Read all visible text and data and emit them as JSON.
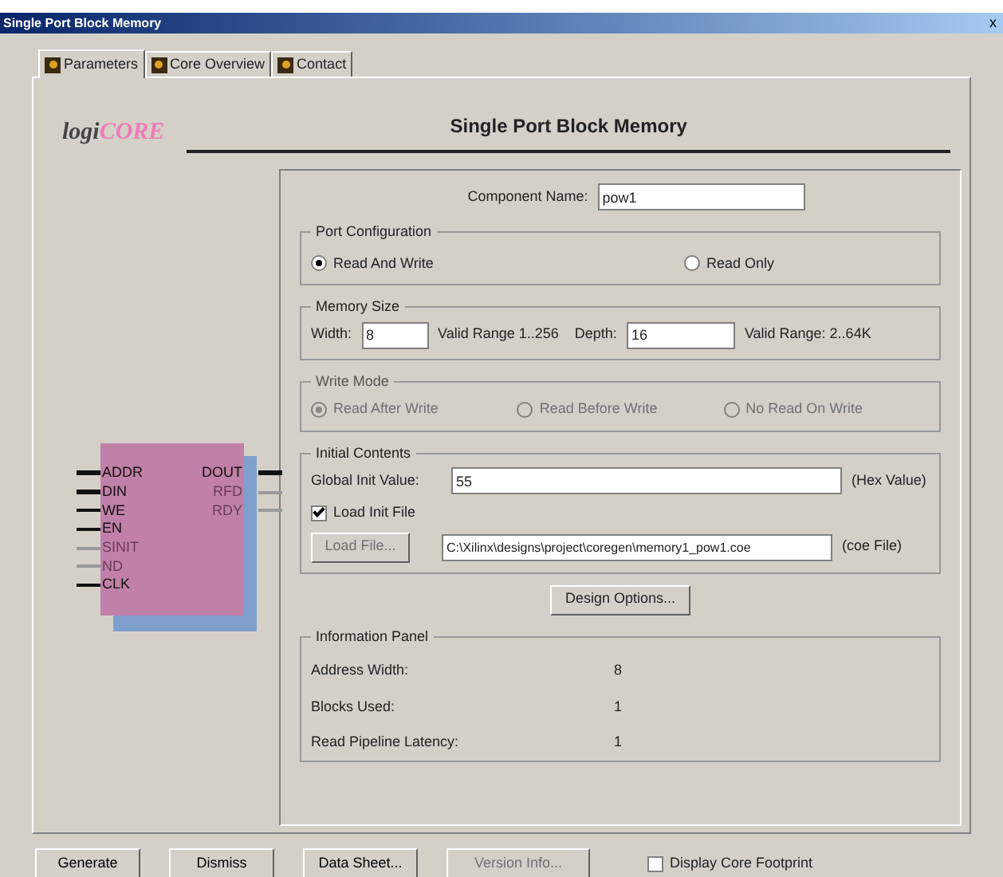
{
  "window": {
    "title": "Single Port Block Memory",
    "close": "x"
  },
  "tabs": [
    {
      "label": "Parameters",
      "selected": true
    },
    {
      "label": "Core Overview",
      "selected": false
    },
    {
      "label": "Contact",
      "selected": false
    }
  ],
  "header": {
    "logo_prefix": "logi",
    "logo_suffix": "CORE",
    "title": "Single Port Block Memory"
  },
  "symbol": {
    "left_pins": [
      {
        "name": "ADDR",
        "bus": true,
        "disabled": false
      },
      {
        "name": "DIN",
        "bus": true,
        "disabled": false
      },
      {
        "name": "WE",
        "bus": false,
        "disabled": false
      },
      {
        "name": "EN",
        "bus": false,
        "disabled": false
      },
      {
        "name": "SINIT",
        "bus": false,
        "disabled": true
      },
      {
        "name": "ND",
        "bus": false,
        "disabled": true
      },
      {
        "name": "CLK",
        "bus": false,
        "disabled": false
      }
    ],
    "right_pins": [
      {
        "name": "DOUT",
        "bus": true,
        "disabled": false
      },
      {
        "name": "RFD",
        "bus": false,
        "disabled": true
      },
      {
        "name": "RDY",
        "bus": false,
        "disabled": true
      }
    ]
  },
  "component_name": {
    "label": "Component Name:",
    "value": "pow1"
  },
  "port_configuration": {
    "title": "Port Configuration",
    "options": [
      {
        "label": "Read And Write",
        "selected": true
      },
      {
        "label": "Read Only",
        "selected": false
      }
    ]
  },
  "memory_size": {
    "title": "Memory Size",
    "width": {
      "label": "Width:",
      "value": "8",
      "range": "Valid Range 1..256"
    },
    "depth": {
      "label": "Depth:",
      "value": "16",
      "range": "Valid Range: 2..64K"
    }
  },
  "write_mode": {
    "title": "Write Mode",
    "disabled": true,
    "options": [
      {
        "label": "Read After Write",
        "selected": true
      },
      {
        "label": "Read Before Write",
        "selected": false
      },
      {
        "label": "No Read On Write",
        "selected": false
      }
    ]
  },
  "initial_contents": {
    "title": "Initial Contents",
    "global_init": {
      "label": "Global Init Value:",
      "value": "55",
      "hint": "(Hex Value)"
    },
    "load_init_file": {
      "label": "Load Init File",
      "checked": true
    },
    "load_button": {
      "label": "Load File...",
      "disabled": true
    },
    "file": {
      "value": "C:\\Xilinx\\designs\\project\\coregen\\memory1_pow1.coe",
      "hint": "(coe File)"
    }
  },
  "design_options_button": "Design Options...",
  "information_panel": {
    "title": "Information Panel",
    "rows": [
      {
        "label": "Address Width:",
        "value": "8"
      },
      {
        "label": "Blocks Used:",
        "value": "1"
      },
      {
        "label": "Read Pipeline Latency:",
        "value": "1"
      }
    ]
  },
  "buttons": [
    {
      "label": "Generate",
      "disabled": false
    },
    {
      "label": "Dismiss",
      "disabled": false
    },
    {
      "label": "Data Sheet...",
      "disabled": false
    },
    {
      "label": "Version Info...",
      "disabled": true
    }
  ],
  "display_core_footprint": {
    "label": "Display Core Footprint",
    "checked": false
  }
}
